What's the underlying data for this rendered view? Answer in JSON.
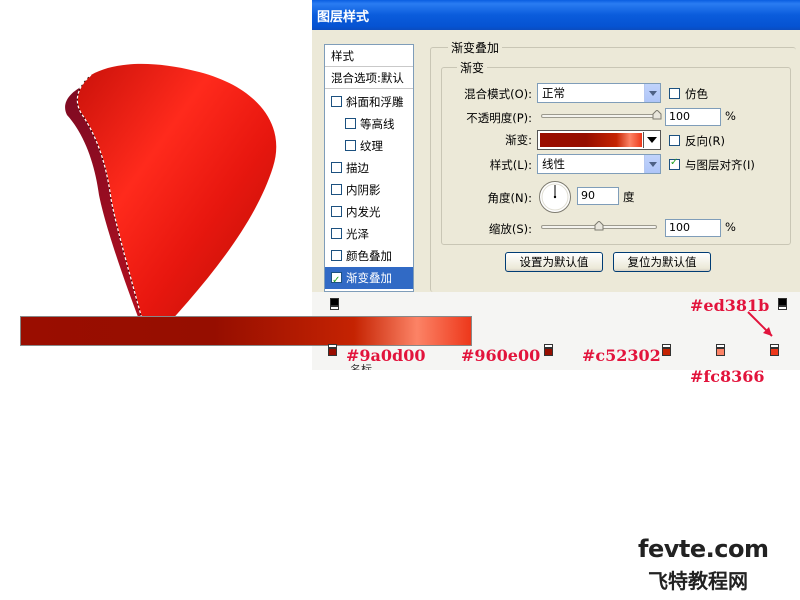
{
  "dialog": {
    "title": "图层样式",
    "style_list": [
      {
        "label": "样式",
        "type": "header"
      },
      {
        "label": "混合选项:默认",
        "type": "header"
      },
      {
        "label": "斜面和浮雕",
        "checked": false,
        "indent": 0
      },
      {
        "label": "等高线",
        "checked": false,
        "indent": 1
      },
      {
        "label": "纹理",
        "checked": false,
        "indent": 1
      },
      {
        "label": "描边",
        "checked": false,
        "indent": 0
      },
      {
        "label": "内阴影",
        "checked": false,
        "indent": 0
      },
      {
        "label": "内发光",
        "checked": false,
        "indent": 0
      },
      {
        "label": "光泽",
        "checked": false,
        "indent": 0
      },
      {
        "label": "颜色叠加",
        "checked": false,
        "indent": 0
      },
      {
        "label": "渐变叠加",
        "checked": true,
        "indent": 0,
        "selected": true
      }
    ],
    "panel": {
      "outer_legend": "渐变叠加",
      "inner_legend": "渐变",
      "blend_mode_label": "混合模式(O):",
      "blend_mode_value": "正常",
      "dither_label": "仿色",
      "dither_checked": false,
      "opacity_label": "不透明度(P):",
      "opacity_value": "100",
      "opacity_unit": "%",
      "opacity_level": 1.0,
      "gradient_label": "渐变:",
      "reverse_label": "反向(R)",
      "reverse_checked": false,
      "style_label": "样式(L):",
      "style_value": "线性",
      "align_label": "与图层对齐(I)",
      "align_checked": true,
      "angle_label": "角度(N):",
      "angle_value": "90",
      "angle_unit": "度",
      "scale_label": "缩放(S):",
      "scale_value": "100",
      "scale_unit": "%",
      "scale_level": 0.5,
      "set_default_button": "设置为默认值",
      "reset_default_button": "复位为默认值"
    },
    "partial_text": "名标"
  },
  "gradient_editor": {
    "color_stops": [
      {
        "color": "#9a0d00",
        "location": 0
      },
      {
        "color": "#960e00",
        "location": 0.48
      },
      {
        "color": "#c52302",
        "location": 0.74
      },
      {
        "color": "#fc8366",
        "location": 0.86
      },
      {
        "color": "#ed381b",
        "location": 0.98
      }
    ],
    "opacity_stops": [
      {
        "location": 0
      },
      {
        "location": 1
      }
    ]
  },
  "annotations": {
    "c1": "#9a0d00",
    "c2": "#960e00",
    "c3": "#c52302",
    "c4": "#fc8366",
    "c5": "#ed381b"
  },
  "watermark": {
    "site": "fevte.com",
    "name_zh": "飞特教程网"
  },
  "colors": {
    "accent_red": "#e2143c",
    "selection_blue": "#316ac5",
    "petal_red": "#e8170f"
  }
}
